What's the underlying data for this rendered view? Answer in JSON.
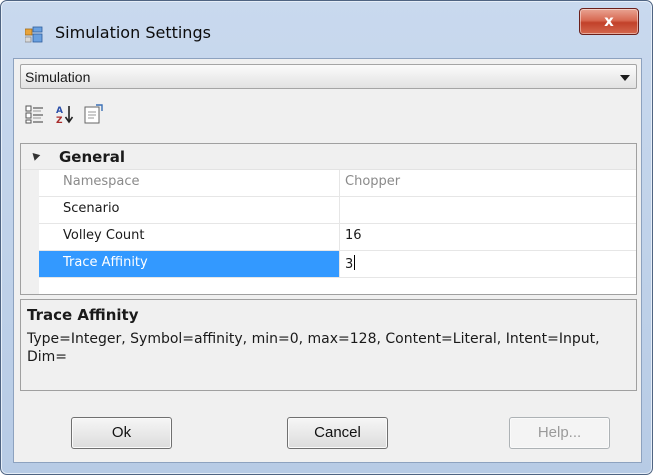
{
  "window": {
    "title": "Simulation Settings",
    "close_glyph": "x"
  },
  "combo": {
    "selected": "Simulation"
  },
  "grid": {
    "category": "General",
    "rows": [
      {
        "name": "Namespace",
        "value": "Chopper",
        "readonly": true
      },
      {
        "name": "Scenario",
        "value": ""
      },
      {
        "name": "Volley Count",
        "value": "16"
      },
      {
        "name": "Trace Affinity",
        "value": "3",
        "selected": true
      }
    ]
  },
  "help": {
    "title": "Trace Affinity",
    "description": "Type=Integer, Symbol=affinity, min=0, max=128, Content=Literal, Intent=Input, Dim="
  },
  "buttons": {
    "ok": "Ok",
    "cancel": "Cancel",
    "help": "Help..."
  },
  "icons": {
    "app": "app-window-icon",
    "toolbar": [
      "categorized-view-icon",
      "alphabetical-sort-icon",
      "property-pages-icon"
    ]
  },
  "colors": {
    "selection": "#3399ff",
    "close_button": "#c2412a"
  }
}
